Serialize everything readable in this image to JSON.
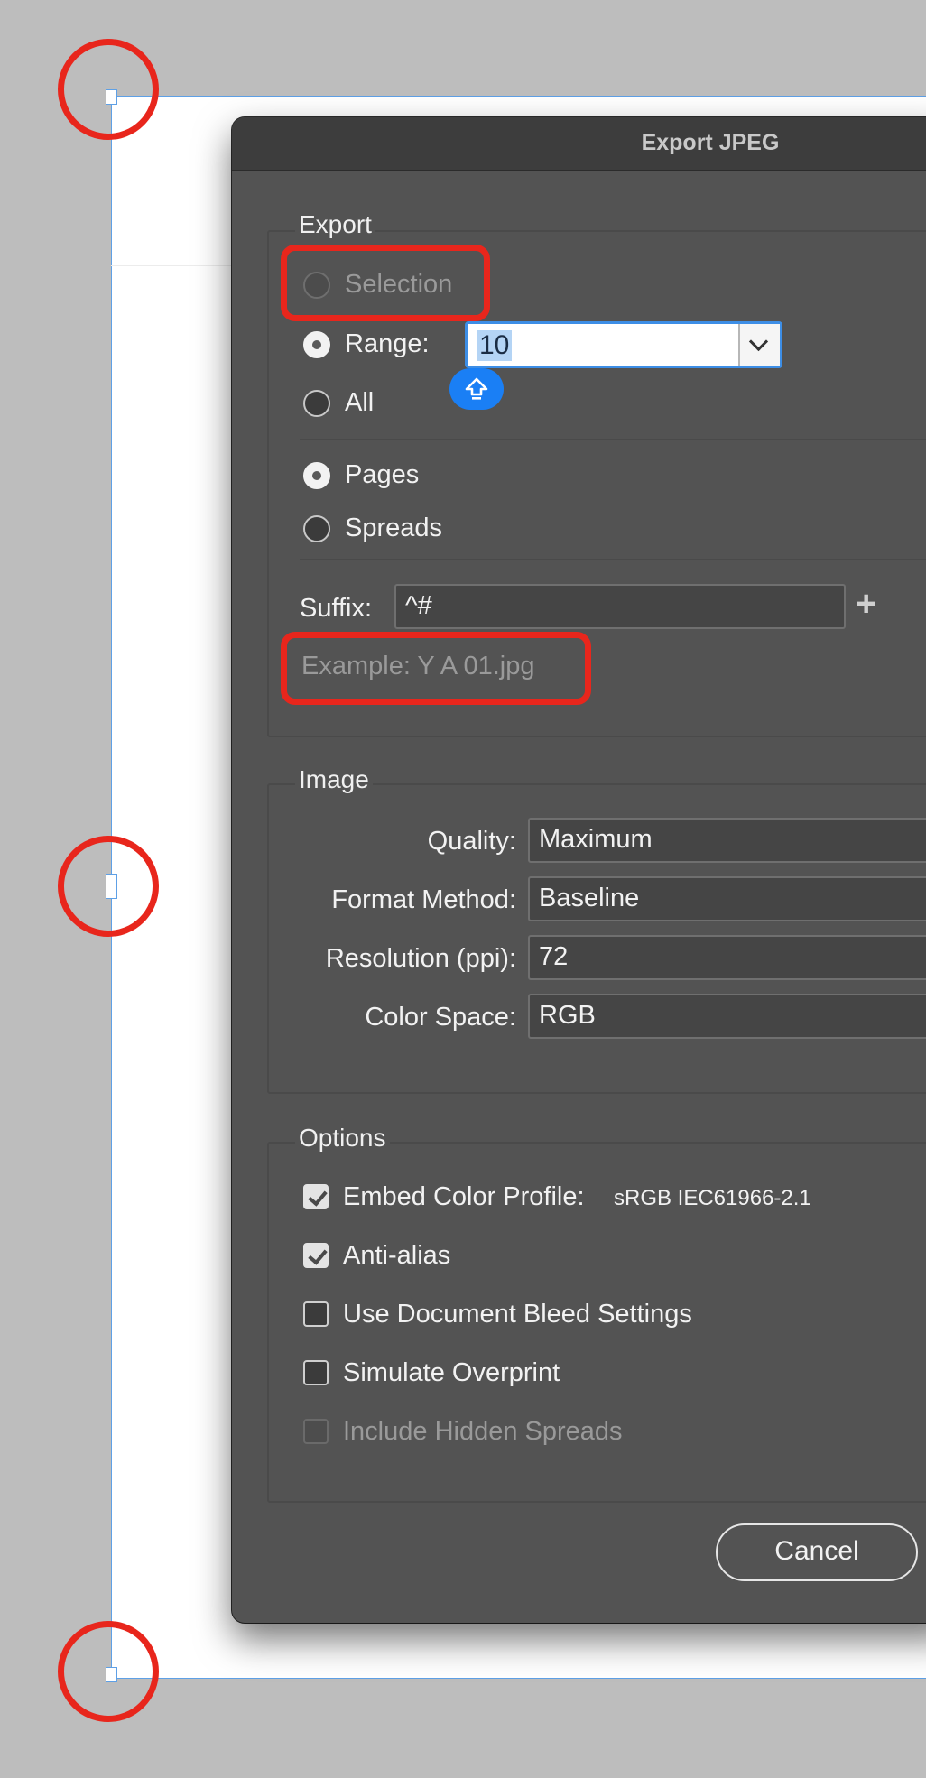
{
  "dialog": {
    "title": "Export JPEG"
  },
  "export": {
    "legend": "Export",
    "selection_label": "Selection",
    "range_label": "Range:",
    "range_value": "10",
    "all_label": "All",
    "pages_label": "Pages",
    "spreads_label": "Spreads",
    "suffix_label": "Suffix:",
    "suffix_value": "^#",
    "add_symbol": "+",
    "example_text": "Example: Y A 01.jpg"
  },
  "image": {
    "legend": "Image",
    "quality_label": "Quality:",
    "quality_value": "Maximum",
    "format_label": "Format Method:",
    "format_value": "Baseline",
    "resolution_label": "Resolution (ppi):",
    "resolution_value": "72",
    "colorspace_label": "Color Space:",
    "colorspace_value": "RGB"
  },
  "options": {
    "legend": "Options",
    "embed_profile_label": "Embed Color Profile:",
    "embed_profile_value": "sRGB IEC61966-2.1",
    "anti_alias_label": "Anti-alias",
    "bleed_label": "Use Document Bleed Settings",
    "overprint_label": "Simulate Overprint",
    "hidden_spreads_label": "Include Hidden Spreads"
  },
  "buttons": {
    "cancel_label": "Cancel"
  },
  "icons": {
    "caps_lock": "caps-lock-icon",
    "dropdown": "chevron-down-icon",
    "plus": "plus-icon"
  },
  "colors": {
    "highlight": "#e8261c",
    "accent": "#3d8ee6",
    "dialog_bg": "#535353"
  }
}
